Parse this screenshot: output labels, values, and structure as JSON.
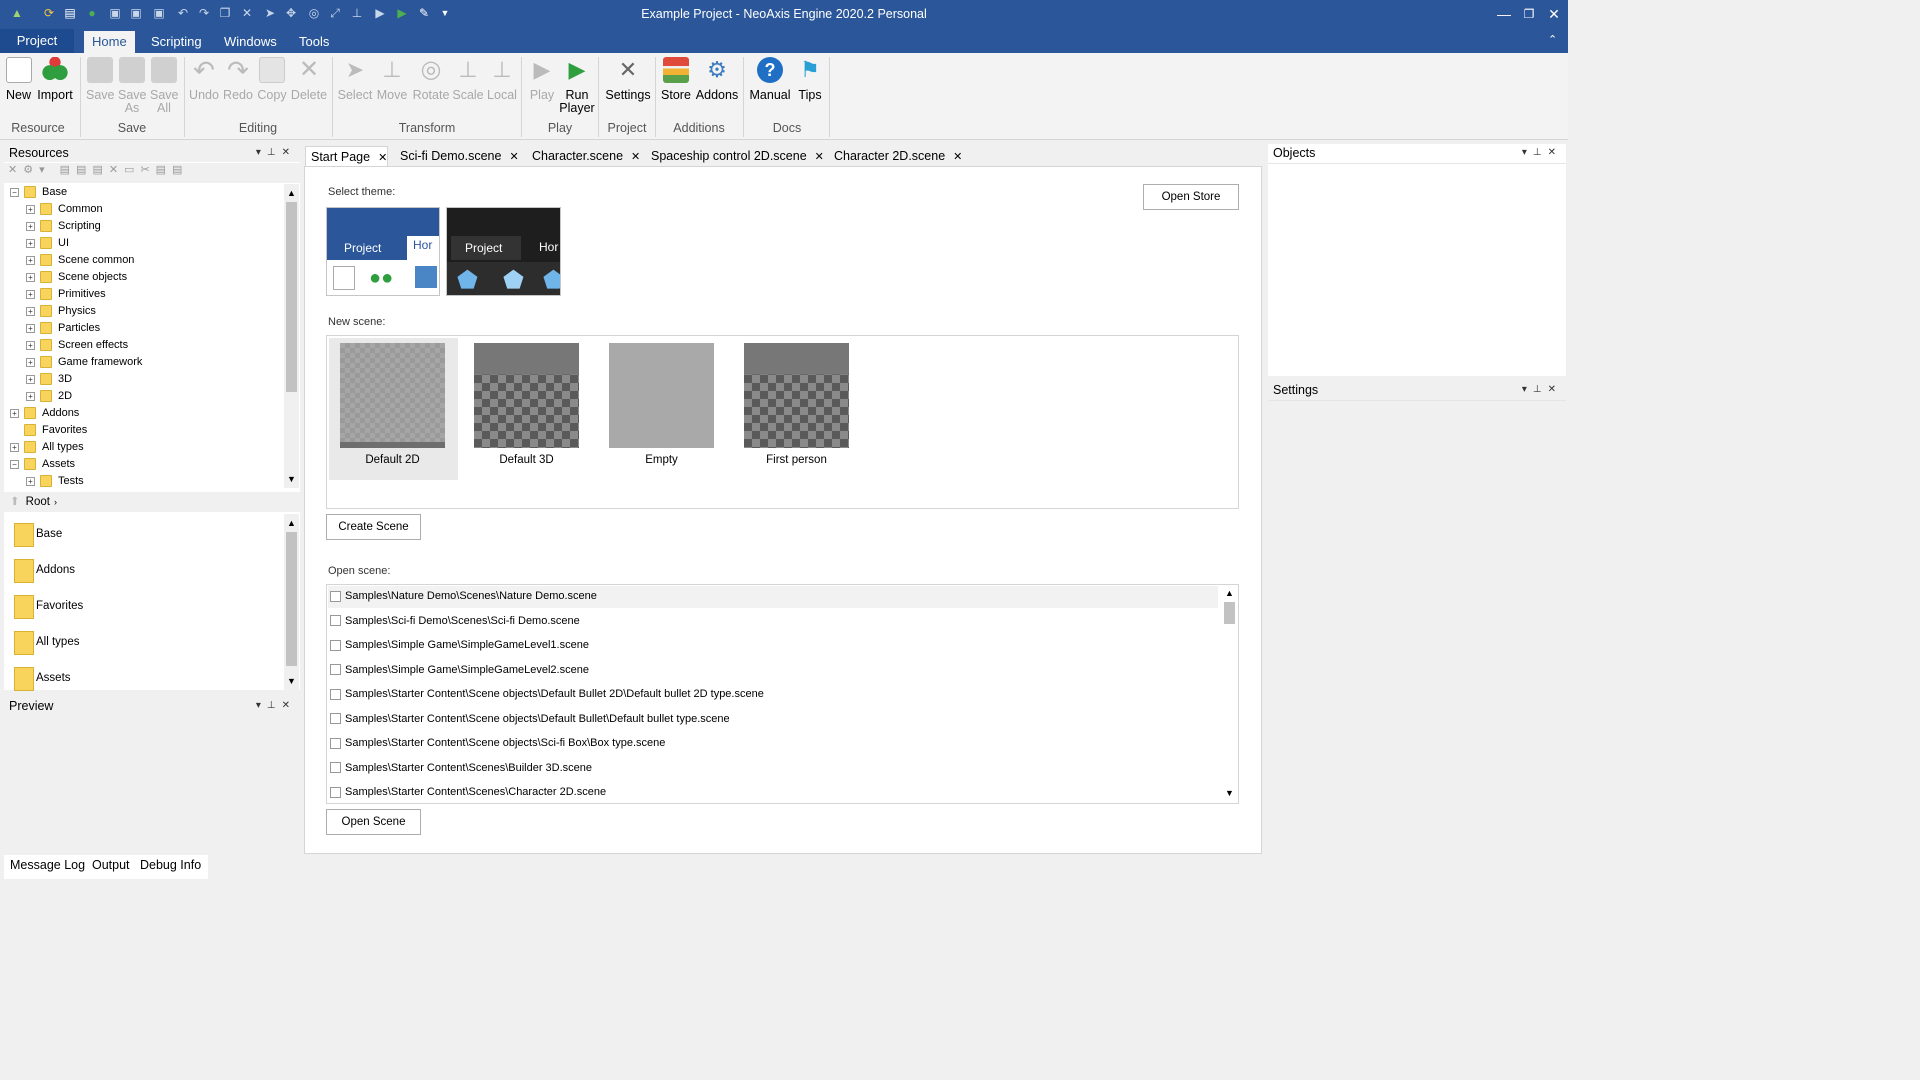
{
  "window": {
    "title": "Example Project - NeoAxis Engine 2020.2 Personal"
  },
  "ribbon_tabs": {
    "project": "Project",
    "home": "Home",
    "scripting": "Scripting",
    "windows": "Windows",
    "tools": "Tools"
  },
  "ribbon": {
    "new": "New",
    "import": "Import",
    "save": "Save",
    "save_as_1": "Save",
    "save_as_2": "As",
    "save_all_1": "Save",
    "save_all_2": "All",
    "undo": "Undo",
    "redo": "Redo",
    "copy": "Copy",
    "delete": "Delete",
    "select": "Select",
    "move": "Move",
    "rotate": "Rotate",
    "scale": "Scale",
    "local": "Local",
    "play": "Play",
    "run_player_1": "Run",
    "run_player_2": "Player",
    "settings": "Settings",
    "store": "Store",
    "addons": "Addons",
    "manual": "Manual",
    "tips": "Tips",
    "groups": {
      "resource": "Resource",
      "save": "Save",
      "editing": "Editing",
      "transform": "Transform",
      "play": "Play",
      "project": "Project",
      "additions": "Additions",
      "docs": "Docs"
    }
  },
  "resources": {
    "title": "Resources",
    "tree": [
      "Base",
      "Common",
      "Scripting",
      "UI",
      "Scene common",
      "Scene objects",
      "Primitives",
      "Physics",
      "Particles",
      "Screen effects",
      "Game framework",
      "3D",
      "2D",
      "Addons",
      "Favorites",
      "All types",
      "Assets",
      "Tests"
    ],
    "breadcrumb": "Root",
    "list": [
      "Base",
      "Addons",
      "Favorites",
      "All types",
      "Assets"
    ]
  },
  "preview": {
    "title": "Preview"
  },
  "doc_tabs": [
    "Start Page",
    "Sci-fi Demo.scene",
    "Character.scene",
    "Spaceship control 2D.scene",
    "Character 2D.scene"
  ],
  "start_page": {
    "select_theme": "Select theme:",
    "open_store": "Open Store",
    "theme_project_label": "Project",
    "theme_home_label": "Hor",
    "new_scene": "New scene:",
    "scenes": [
      "Default 2D",
      "Default 3D",
      "Empty",
      "First person"
    ],
    "create_scene": "Create Scene",
    "open_scene_label": "Open scene:",
    "open_scenes": [
      "Samples\\Nature Demo\\Scenes\\Nature Demo.scene",
      "Samples\\Sci-fi Demo\\Scenes\\Sci-fi Demo.scene",
      "Samples\\Simple Game\\SimpleGameLevel1.scene",
      "Samples\\Simple Game\\SimpleGameLevel2.scene",
      "Samples\\Starter Content\\Scene objects\\Default Bullet 2D\\Default bullet 2D type.scene",
      "Samples\\Starter Content\\Scene objects\\Default Bullet\\Default bullet type.scene",
      "Samples\\Starter Content\\Scene objects\\Sci-fi Box\\Box type.scene",
      "Samples\\Starter Content\\Scenes\\Builder 3D.scene",
      "Samples\\Starter Content\\Scenes\\Character 2D.scene"
    ],
    "open_scene": "Open Scene"
  },
  "objects": {
    "title": "Objects"
  },
  "settings_panel": {
    "title": "Settings"
  },
  "bottom_tabs": [
    "Message Log",
    "Output",
    "Debug Info"
  ],
  "colors": {
    "accent": "#2b579a",
    "tab_bar": "#1e4a8f"
  }
}
